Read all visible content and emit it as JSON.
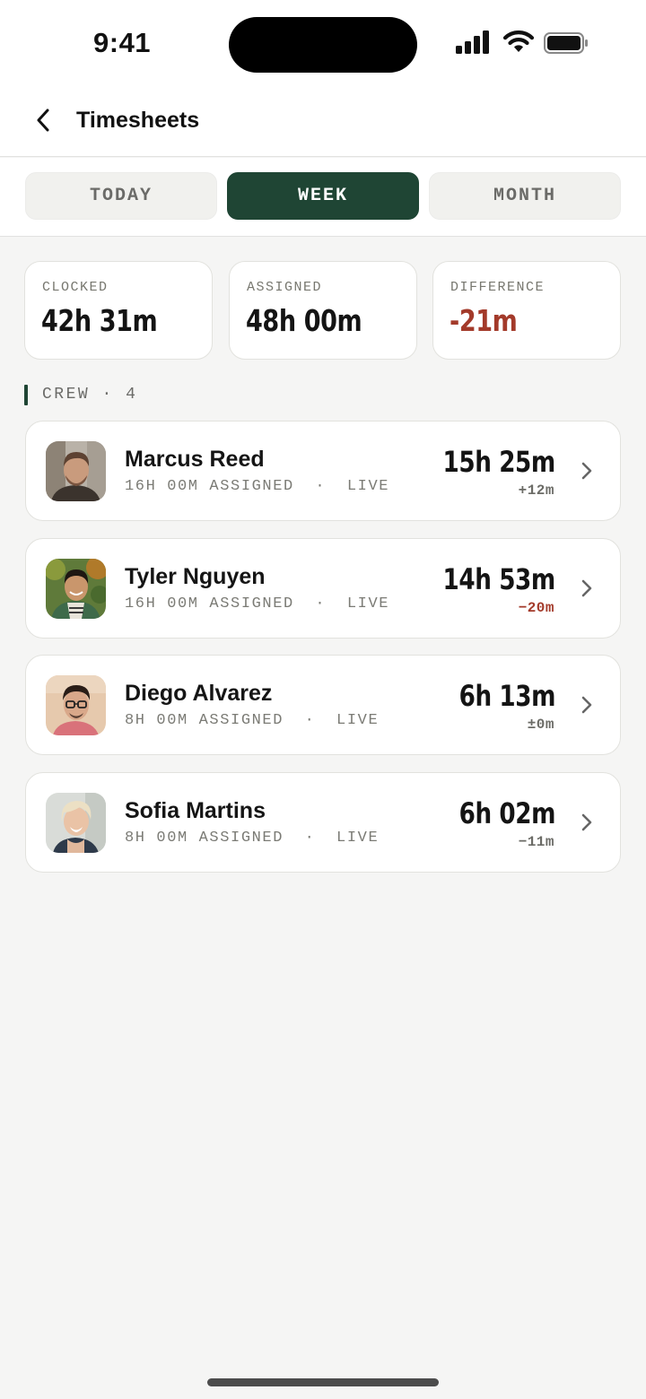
{
  "status_bar": {
    "time": "9:41"
  },
  "header": {
    "title": "Timesheets"
  },
  "tabs": [
    {
      "label": "TODAY",
      "active": false
    },
    {
      "label": "WEEK",
      "active": true
    },
    {
      "label": "MONTH",
      "active": false
    }
  ],
  "summary": [
    {
      "label": "CLOCKED",
      "value": "42h 31m"
    },
    {
      "label": "ASSIGNED",
      "value": "48h 00m"
    },
    {
      "label": "DIFFERENCE",
      "value": "-21m"
    }
  ],
  "section": {
    "label": "CREW · 4"
  },
  "crew": [
    {
      "name": "Marcus Reed",
      "meta": "16H 00M ASSIGNED  ·  LIVE",
      "hours": "15h 25m",
      "delta": "+12m",
      "avatar": "avatar-photo"
    },
    {
      "name": "Tyler Nguyen",
      "meta": "16H 00M ASSIGNED  ·  LIVE",
      "hours": "14h 53m",
      "delta": "−20m",
      "avatar": "avatar-photo"
    },
    {
      "name": "Diego Alvarez",
      "meta": "8H 00M ASSIGNED  ·  LIVE",
      "hours": "6h 13m",
      "delta": "±0m",
      "avatar": "avatar-photo"
    },
    {
      "name": "Sofia Martins",
      "meta": "8H 00M ASSIGNED  ·  LIVE",
      "hours": "6h 02m",
      "delta": "−11m",
      "avatar": "avatar-photo"
    }
  ],
  "colors": {
    "accent": "#1f4534",
    "negative": "#a33a2a",
    "background": "#f5f5f4"
  }
}
